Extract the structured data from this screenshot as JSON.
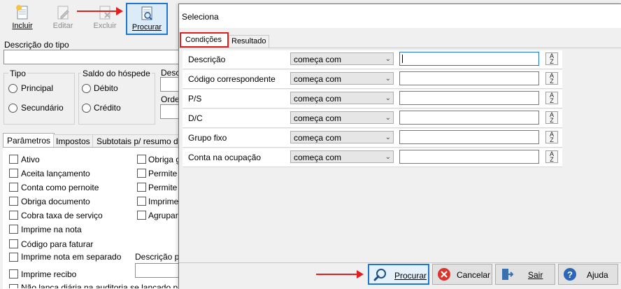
{
  "toolbar": {
    "incluir": "Incluir",
    "editar": "Editar",
    "excluir": "Excluir",
    "procurar": "Procurar"
  },
  "left_form": {
    "descricao_tipo_label": "Descrição do tipo",
    "tipo_label": "Tipo",
    "tipo_principal": "Principal",
    "tipo_secundario": "Secundário",
    "saldo_label": "Saldo do hóspede",
    "saldo_debito": "Débito",
    "saldo_credito": "Crédito",
    "desc_partial": "Desc",
    "orde_partial": "Orde",
    "tabs": [
      "Parâmetros",
      "Impostos",
      "Subtotais p/ resumo da"
    ],
    "checkboxes_left": [
      "Ativo",
      "Aceita lançamento",
      "Conta como pernoite",
      "Obriga documento",
      "Cobra taxa de serviço",
      "Imprime na nota",
      "Código para faturar",
      "Imprime nota em separado",
      "Imprime recibo"
    ],
    "checkboxes_right": [
      "Obriga g",
      "Permite e",
      "Permite s",
      "Imprime",
      "Agrupar"
    ],
    "descricao_pa_label": "Descrição pa",
    "bottom_cut_text": "Não lança diária na auditoria se lançado para o mesmo"
  },
  "dialog": {
    "title": "Seleciona",
    "tabs": [
      "Condições",
      "Resultado"
    ],
    "rows": [
      {
        "label": "Descrição",
        "operator": "começa com",
        "value": ""
      },
      {
        "label": "Código correspondente",
        "operator": "começa com",
        "value": ""
      },
      {
        "label": "P/S",
        "operator": "começa com",
        "value": ""
      },
      {
        "label": "D/C",
        "operator": "começa com",
        "value": ""
      },
      {
        "label": "Grupo fixo",
        "operator": "começa com",
        "value": ""
      },
      {
        "label": "Conta na ocupação",
        "operator": "começa com",
        "value": ""
      }
    ],
    "buttons": {
      "procurar": "Procurar",
      "cancelar": "Cancelar",
      "sair": "Sair",
      "ajuda": "Ajuda"
    }
  },
  "colors": {
    "highlight_red": "#e02020",
    "focus_blue": "#1e78d2"
  }
}
